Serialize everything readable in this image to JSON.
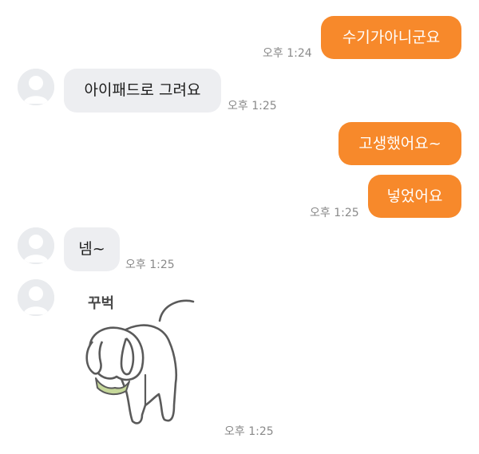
{
  "messages": [
    {
      "text": "수기가아니군요",
      "time": "오후 1:24"
    },
    {
      "text": "아이패드로 그려요",
      "time": "오후 1:25"
    },
    {
      "text": "고생했어요~"
    },
    {
      "text": "넣었어요",
      "time": "오후 1:25"
    },
    {
      "text": "넴~",
      "time": "오후 1:25"
    },
    {
      "sticker_caption": "꾸벅",
      "time": "오후 1:25"
    }
  ],
  "colors": {
    "outgoing": "#f7892b",
    "incoming": "#edeef1",
    "time": "#8a8a8a"
  },
  "icons": {
    "avatar": "default-profile-icon",
    "sticker": "bowing-dog-sticker"
  }
}
